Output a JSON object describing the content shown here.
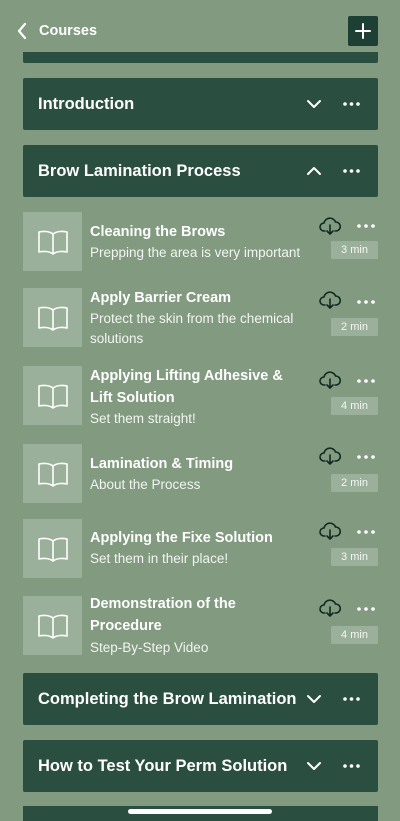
{
  "header": {
    "back_label": "Courses",
    "back_icon": "chevron-left-icon",
    "add_icon": "plus-icon"
  },
  "sections": [
    {
      "title": "Introduction",
      "expanded": false
    },
    {
      "title": "Brow Lamination Process",
      "expanded": true
    },
    {
      "title": "Completing the Brow Lamination",
      "expanded": false
    },
    {
      "title": "How to Test Your Perm Solution",
      "expanded": false
    }
  ],
  "lessons": [
    {
      "title": "Cleaning the Brows",
      "subtitle": "Prepping the area is very important",
      "duration": "3 min"
    },
    {
      "title": "Apply Barrier Cream",
      "subtitle": "Protect the skin from the chemical solutions",
      "duration": "2 min"
    },
    {
      "title": "Applying Lifting Adhesive & Lift Solution",
      "subtitle": "Set them straight!",
      "duration": "4 min"
    },
    {
      "title": "Lamination & Timing",
      "subtitle": "About the Process",
      "duration": "2 min"
    },
    {
      "title": "Applying the Fixe Solution",
      "subtitle": "Set them in their place!",
      "duration": "3 min"
    },
    {
      "title": "Demonstration of the Procedure",
      "subtitle": "Step-By-Step Video",
      "duration": "4 min"
    }
  ],
  "colors": {
    "background": "#819a80",
    "section_bg": "#2a4e3f",
    "thumb_bg": "#9bb09a",
    "text": "#ffffff"
  }
}
